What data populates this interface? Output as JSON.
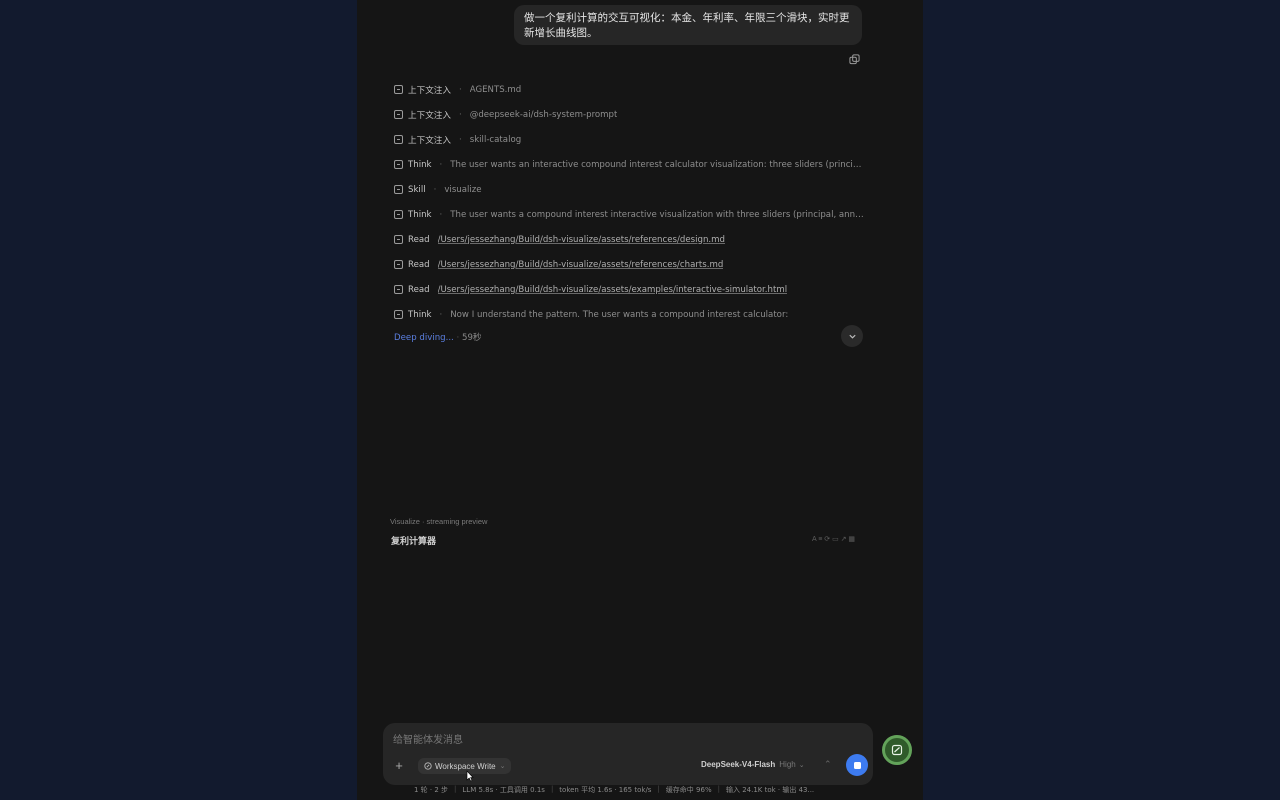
{
  "user_message": "做一个复利计算的交互可视化：本金、年利率、年限三个滑块，实时更新增长曲线图。",
  "steps": [
    {
      "icon": "document-icon",
      "label": "上下文注入",
      "value": "AGENTS.md",
      "link": false
    },
    {
      "icon": "document-icon",
      "label": "上下文注入",
      "value": "@deepseek-ai/dsh-system-prompt",
      "link": false
    },
    {
      "icon": "document-icon",
      "label": "上下文注入",
      "value": "skill-catalog",
      "link": false
    },
    {
      "icon": "think-icon",
      "label": "Think",
      "value": "The user wants an interactive compound interest calculator visualization: three sliders (principal, annu...",
      "link": false
    },
    {
      "icon": "skill-icon",
      "label": "Skill",
      "value": "visualize",
      "link": false
    },
    {
      "icon": "think-icon",
      "label": "Think",
      "value": "The user wants a compound interest interactive visualization with three sliders (principal, annual intere...",
      "link": false
    },
    {
      "icon": "read-icon",
      "label": "Read",
      "value": "/Users/jessezhang/Build/dsh-visualize/assets/references/design.md",
      "link": true
    },
    {
      "icon": "read-icon",
      "label": "Read",
      "value": "/Users/jessezhang/Build/dsh-visualize/assets/references/charts.md",
      "link": true
    },
    {
      "icon": "read-icon",
      "label": "Read",
      "value": "/Users/jessezhang/Build/dsh-visualize/assets/examples/interactive-simulator.html",
      "link": true
    },
    {
      "icon": "think-icon",
      "label": "Think",
      "value": "Now I understand the pattern. The user wants a compound interest calculator:",
      "link": false
    }
  ],
  "status": {
    "activity": "Deep diving...",
    "elapsed": "59秒"
  },
  "visualize": {
    "header": "Visualize · streaming preview",
    "title": "复利计算器",
    "tools": "A ≡ ⟳ ▭ ↗   ▦"
  },
  "composer": {
    "placeholder": "给智能体发消息",
    "value": ""
  },
  "mode": {
    "label": "Workspace Write"
  },
  "model": {
    "name": "DeepSeek-V4-Flash",
    "effort": "High"
  },
  "footer": {
    "turns": "1 轮 · 2 步",
    "llm": "LLM 5.8s · 工具调用 0.1s",
    "token_rate": "token 平均 1.6s · 165 tok/s",
    "cache": "缓存命中 96%",
    "io": "输入 24.1K tok · 输出 43..."
  },
  "colors": {
    "accent": "#3d7bf0",
    "fab": "#63a35a",
    "background": "#121a2e",
    "panel": "#151515"
  }
}
